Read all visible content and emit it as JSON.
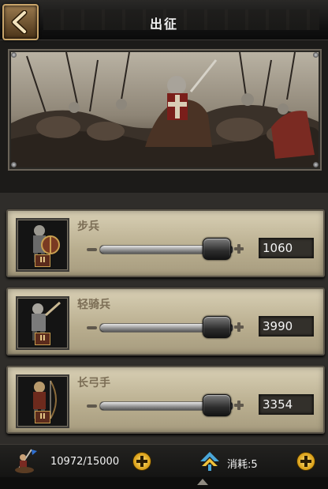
{
  "header": {
    "title": "出征"
  },
  "units": [
    {
      "name": "步兵",
      "count": "1060",
      "rank": "II",
      "level": 0.88
    },
    {
      "name": "轻骑兵",
      "count": "3990",
      "rank": "II",
      "level": 0.88
    },
    {
      "name": "长弓手",
      "count": "3354",
      "rank": "II",
      "level": 0.88
    }
  ],
  "footer": {
    "troops": "10972/15000",
    "consume": "消耗:5"
  },
  "icons": {
    "back": "back-chevron-icon",
    "troops": "soldier-icon",
    "consume": "marching-army-icon"
  },
  "colors": {
    "card": "#d8cfb4",
    "label": "#7b6d55",
    "gold_button": "#d79b12"
  }
}
